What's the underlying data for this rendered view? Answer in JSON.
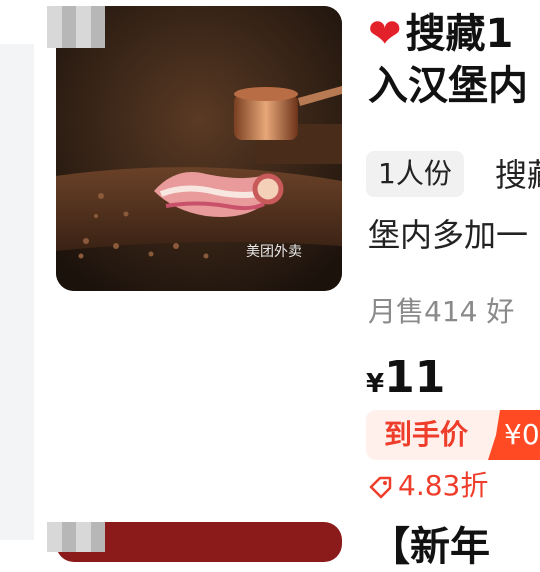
{
  "item1": {
    "title_line1": "搜藏1",
    "title_line2": "入汉堡内",
    "tag": "1人份",
    "desc_line1": "搜藏",
    "desc_line2": "堡内多加一",
    "sales": "月售414  好",
    "currency": "¥",
    "price": "11",
    "deal_label": "到手价",
    "deal_price": "¥0",
    "discount": "4.83折",
    "image_watermark": "美团外卖",
    "icons": [
      "heart-icon",
      "discount-tag-icon"
    ]
  },
  "item2": {
    "title": "【新年"
  },
  "colors": {
    "accent": "#ef3d2b",
    "heart": "#e3212b",
    "muted": "#8a8a8a",
    "tag_bg": "#f1f1f1"
  }
}
